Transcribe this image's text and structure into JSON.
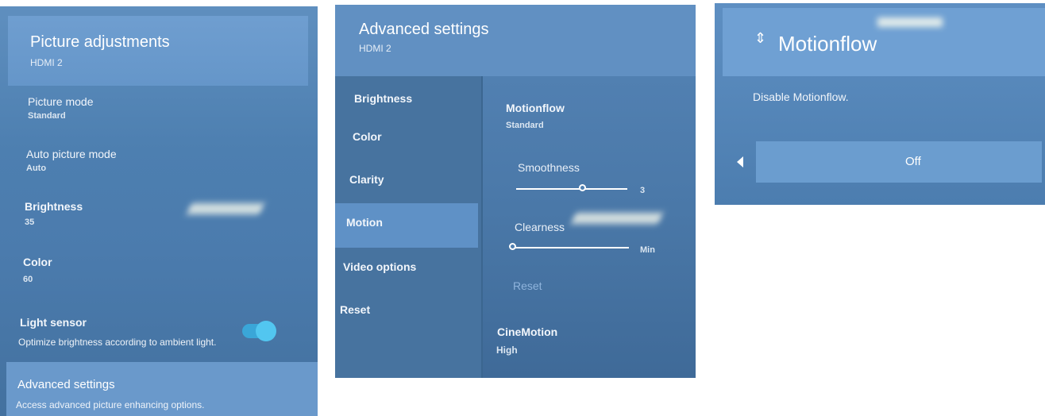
{
  "picture_adjustments": {
    "title": "Picture adjustments",
    "source": "HDMI 2",
    "items": [
      {
        "label": "Picture mode",
        "value": "Standard"
      },
      {
        "label": "Auto picture mode",
        "value": "Auto"
      },
      {
        "label": "Brightness",
        "value": "35"
      },
      {
        "label": "Color",
        "value": "60"
      }
    ],
    "light_sensor": {
      "label": "Light sensor",
      "description": "Optimize brightness according to ambient light.",
      "enabled": true
    },
    "advanced": {
      "label": "Advanced settings",
      "description": "Access advanced picture enhancing options."
    }
  },
  "advanced_settings": {
    "title": "Advanced settings",
    "source": "HDMI 2",
    "categories": [
      "Brightness",
      "Color",
      "Clarity",
      "Motion",
      "Video options",
      "Reset"
    ],
    "selected_category": "Motion",
    "motionflow": {
      "label": "Motionflow",
      "value": "Standard"
    },
    "smoothness": {
      "label": "Smoothness",
      "value": "3",
      "level": 0.6
    },
    "clearness": {
      "label": "Clearness",
      "value": "Min",
      "level": 0.0
    },
    "reset_label": "Reset",
    "cinemotion": {
      "label": "CineMotion",
      "value": "High"
    }
  },
  "motionflow_dialog": {
    "title": "Motionflow",
    "description": "Disable Motionflow.",
    "value": "Off",
    "icons": [
      "up-down-arrows-icon",
      "left-arrow-icon"
    ]
  },
  "colors": {
    "panel_blue": "#4b7bad",
    "header_blue": "#6596c9",
    "selected_blue": "#5f91c6",
    "toggle_accent": "#52c6f0"
  }
}
